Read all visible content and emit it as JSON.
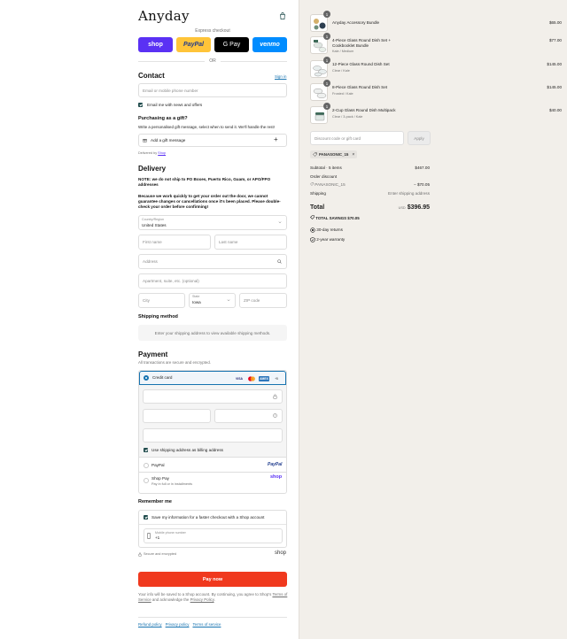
{
  "header": {
    "logo": "Anyday",
    "cart_icon": "bag-icon"
  },
  "express": {
    "label": "Express checkout",
    "buttons": {
      "shop": "shop",
      "paypal": "PayPal",
      "gpay": "G Pay",
      "venmo": "venmo"
    },
    "or": "OR"
  },
  "contact": {
    "title": "Contact",
    "sign_in": "Sign in",
    "email_placeholder": "Email or mobile phone number",
    "news_label": "Email me with news and offers"
  },
  "gift": {
    "title": "Purchasing as a gift?",
    "subtitle": "Write a personalised gift message, select when to send it. We'll handle the rest!",
    "add_label": "Add a gift message",
    "delivered_by": "Delivered by",
    "delivered_by_link": "Shop"
  },
  "delivery": {
    "title": "Delivery",
    "notice1": "NOTE: we do not ship to PO Boxes, Puerto Rico, Guam, or APO/FPO addresses",
    "notice2": "Because we work quickly to get your order out the door, we cannot guarantee changes or cancellations once it's been placed. Please double-check your order before confirming!",
    "country_label": "Country/Region",
    "country_value": "United States",
    "first_name": "First name",
    "last_name": "Last name",
    "address": "Address",
    "apartment": "Apartment, suite, etc. (optional)",
    "city": "City",
    "state_label": "State",
    "state_value": "Iowa",
    "zip": "ZIP code"
  },
  "shipping": {
    "title": "Shipping method",
    "message": "Enter your shipping address to view available shipping methods."
  },
  "payment": {
    "title": "Payment",
    "subtitle": "All transactions are secure and encrypted.",
    "credit_card": "Credit card",
    "card_logos": {
      "visa": "VISA",
      "mc": "MC",
      "amex": "AMEX",
      "more": "+5"
    },
    "billing_label": "Use shipping address as billing address",
    "paypal_label": "PayPal",
    "paypal_logo": "PayPal",
    "shop_pay_label": "Shop Pay",
    "shop_pay_sub": "Pay in full or in installments",
    "shop_pay_logo": "shop"
  },
  "remember": {
    "title": "Remember me",
    "save_label": "Save my information for a faster checkout with a Shop account",
    "phone_label": "Mobile phone number",
    "phone_value": "+1",
    "secure_label": "Secure and encrypted",
    "shop_logo": "shop"
  },
  "pay_now": "Pay now",
  "consent": {
    "text": "Your info will be saved to a Shop account. By continuing, you agree to Shop's",
    "terms": "Terms of Service",
    "and": "and acknowledge the",
    "privacy": "Privacy Policy",
    "end": "."
  },
  "footer": {
    "refund": "Refund policy",
    "privacy": "Privacy policy",
    "terms": "Terms of service"
  },
  "cart": {
    "items": [
      {
        "name": "Anyday Accessory Bundle",
        "variant": "",
        "price": "$65.00",
        "qty": "1"
      },
      {
        "name": "4-Piece Glass Round Dish Set + Cookbooklet Bundle",
        "variant": "Kale / Medium",
        "price": "$77.00",
        "qty": "1"
      },
      {
        "name": "12-Piece Glass Round Dish Set",
        "variant": "Clear / Kale",
        "price": "$145.00",
        "qty": "1"
      },
      {
        "name": "8-Piece Glass Round Dish Set",
        "variant": "Frosted / Kale",
        "price": "$145.00",
        "qty": "1"
      },
      {
        "name": "2-Cup Glass Round Dish Multipack",
        "variant": "Clear / 3-pack / Kale",
        "price": "$40.00",
        "qty": "1"
      }
    ],
    "discount_placeholder": "Discount code or gift card",
    "apply": "Apply",
    "code": "PANASONIC_15",
    "subtotal_label": "Subtotal · 5 items",
    "subtotal_value": "$467.00",
    "order_discount_label": "Order discount",
    "discount_code_label": "PANASONIC_15",
    "discount_value": "− $70.05",
    "shipping_label": "Shipping",
    "shipping_value": "Enter shipping address",
    "total_label": "Total",
    "currency": "USD",
    "total_value": "$396.95",
    "savings": "TOTAL SAVINGS  $70.05",
    "returns": "30-day returns",
    "warranty": "2-year warranty"
  }
}
